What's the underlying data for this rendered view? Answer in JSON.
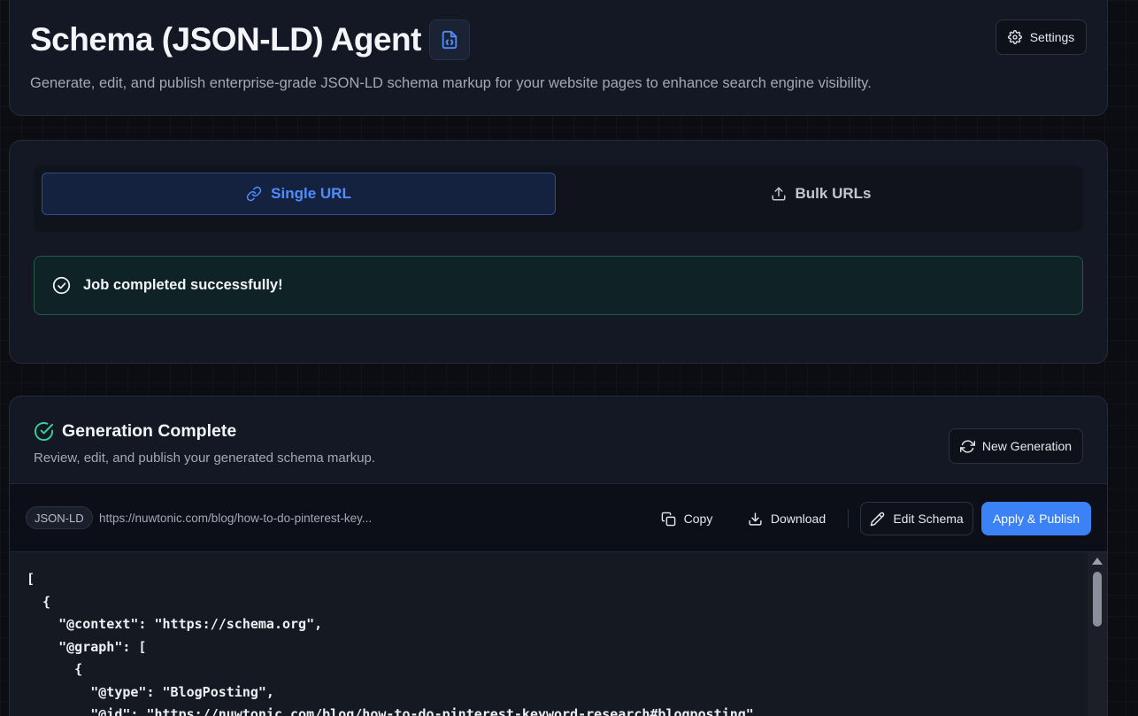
{
  "header": {
    "title": "Schema (JSON-LD) Agent",
    "subtitle": "Generate, edit, and publish enterprise-grade JSON-LD schema markup for your website pages to enhance search engine visibility.",
    "settings_label": "Settings"
  },
  "tabs": [
    {
      "label": "Single URL",
      "icon": "link-icon",
      "active": true
    },
    {
      "label": "Bulk URLs",
      "icon": "upload-icon",
      "active": false
    }
  ],
  "status": {
    "message": "Job completed successfully!",
    "color": "#1f5a4a"
  },
  "results": {
    "title": "Generation Complete",
    "description": "Review, edit, and publish your generated schema markup.",
    "new_generation_label": "New Generation",
    "format_badge": "JSON-LD",
    "url": "https://nuwtonic.com/blog/how-to-do-pinterest-key...",
    "copy_label": "Copy",
    "download_label": "Download",
    "edit_label": "Edit Schema",
    "publish_label": "Apply & Publish",
    "code_lines": [
      "[",
      "  {",
      "    \"@context\": \"https://schema.org\",",
      "    \"@graph\": [",
      "      {",
      "        \"@type\": \"BlogPosting\",",
      "        \"@id\": \"https://nuwtonic.com/blog/how-to-do-pinterest-keyword-research#blogposting\","
    ]
  },
  "colors": {
    "accent": "#3b82f6",
    "success": "#34d399",
    "background": "#0b0d13"
  }
}
